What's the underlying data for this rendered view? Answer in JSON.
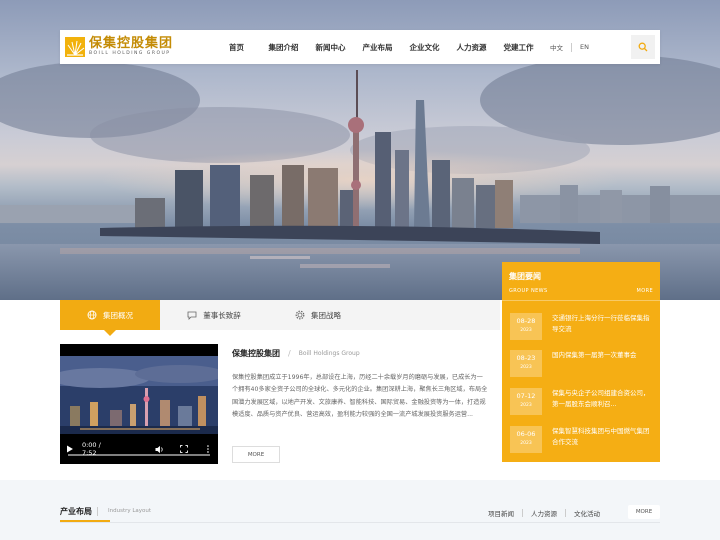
{
  "header": {
    "logo_cn": "保集控股集团",
    "logo_en": "BOILL HOLDING GROUP",
    "nav": [
      "首页",
      "集团介绍",
      "新闻中心",
      "产业布局",
      "企业文化",
      "人力资源",
      "党建工作"
    ],
    "lang_cn": "中文",
    "lang_en": "EN",
    "search_icon": "search-icon"
  },
  "news": {
    "title": "集团要闻",
    "subtitle": "GROUP NEWS",
    "more": "MORE",
    "items": [
      {
        "md": "08-28",
        "year": "2023",
        "text": "交通银行上海分行一行莅临保集指导交流"
      },
      {
        "md": "08-23",
        "year": "2023",
        "text": "国内保集第一届第一次董事会"
      },
      {
        "md": "07-12",
        "year": "2023",
        "text": "保集与央企子公司组建合资公司，第一届股东会顺利召..."
      },
      {
        "md": "06-06",
        "year": "2023",
        "text": "保集智慧科技集团与中国燃气集团合作交流"
      }
    ]
  },
  "tabs": [
    {
      "label": "集团概况",
      "icon": "globe-icon",
      "active": true
    },
    {
      "label": "董事长致辞",
      "icon": "chat-icon",
      "active": false
    },
    {
      "label": "集团战略",
      "icon": "gear-icon",
      "active": false
    }
  ],
  "video": {
    "time": "0:00 / 7:52",
    "progress": 0
  },
  "intro": {
    "title_cn": "保集控股集团",
    "slash": "/",
    "title_en": "Boill Holdings Group",
    "body": "保集控股集团成立于1996年，总部设在上海，历经二十余载岁月的磨砺与发展，已成长为一个拥有40多家全资子公司的全球化、多元化的企业。集团深耕上海，聚焦长三角区域，布局全国潜力发展区域，以地产开发、文旅康养、智能科技、国际贸易、金融投资等为一体，打造规模适度、品质与资产优良、营运高效，盈利能力较强的全国一流产城发展投资服务运营...",
    "more": "MORE"
  },
  "industry": {
    "title": "产业布局",
    "title_en": "Industry Layout",
    "links": [
      "项目新闻",
      "人力资源",
      "文化活动"
    ],
    "more": "MORE"
  },
  "colors": {
    "accent": "#f2ab12",
    "logo": "#c48c06"
  }
}
